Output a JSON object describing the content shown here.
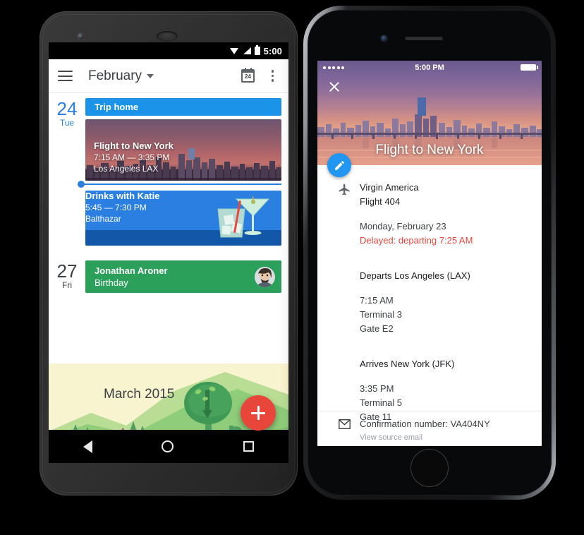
{
  "android": {
    "status": {
      "time": "5:00",
      "icons": [
        "wifi-icon",
        "signal-icon",
        "battery-icon"
      ]
    },
    "appbar": {
      "menu_icon": "hamburger-menu-icon",
      "title": "February",
      "dropdown_icon": "chevron-down-icon",
      "today_icon": "calendar-today-icon",
      "today_number": "24",
      "overflow_icon": "overflow-menu-icon"
    },
    "days": [
      {
        "num": "24",
        "dow": "Tue",
        "events": [
          {
            "kind": "trip",
            "title": "Trip home"
          },
          {
            "kind": "flight",
            "title": "Flight to New York",
            "time": "7:15 AM — 3:35 PM",
            "location": "Los Angeles LAX"
          },
          {
            "kind": "drinks",
            "title": "Drinks with Katie",
            "time": "5:45 — 7:30 PM",
            "location": "Balthazar"
          }
        ]
      },
      {
        "num": "27",
        "dow": "Fri",
        "events": [
          {
            "kind": "birthday",
            "title": "Jonathan Aroner",
            "subtitle": "Birthday"
          }
        ]
      }
    ],
    "month_art_label": "March 2015",
    "fab": {
      "icon": "add-icon",
      "label": "+"
    },
    "navbar": {
      "back_icon": "nav-back-icon",
      "home_icon": "nav-home-icon",
      "recents_icon": "nav-recents-icon"
    }
  },
  "ios": {
    "status": {
      "signal_dots": 5,
      "time": "5:00 PM",
      "battery_icon": "battery-icon"
    },
    "close_icon": "close-icon",
    "hero_title": "Flight to New York",
    "edit_fab_icon": "edit-pencil-icon",
    "flight": {
      "icon": "airplane-icon",
      "airline": "Virgin America",
      "flight_number": "Flight 404",
      "date": "Monday, February 23",
      "delay": "Delayed: departing 7:25 AM",
      "departs_heading": "Departs Los Angeles (LAX)",
      "departs_time": "7:15 AM",
      "departs_terminal": "Terminal 3",
      "departs_gate": "Gate E2",
      "arrives_heading": "Arrives New York (JFK)",
      "arrives_time": "3:35 PM",
      "arrives_terminal": "Terminal 5",
      "arrives_gate": "Gate 11"
    },
    "confirmation": {
      "icon": "envelope-icon",
      "text": "Confirmation number: VA404NY",
      "link": "View source email"
    }
  },
  "colors": {
    "android_blue": "#2a7fe0",
    "trip_blue": "#1a93e8",
    "green": "#2aa05a",
    "red_fab": "#e8463b",
    "ios_blue": "#2196f3",
    "delay_red": "#e8463b"
  }
}
